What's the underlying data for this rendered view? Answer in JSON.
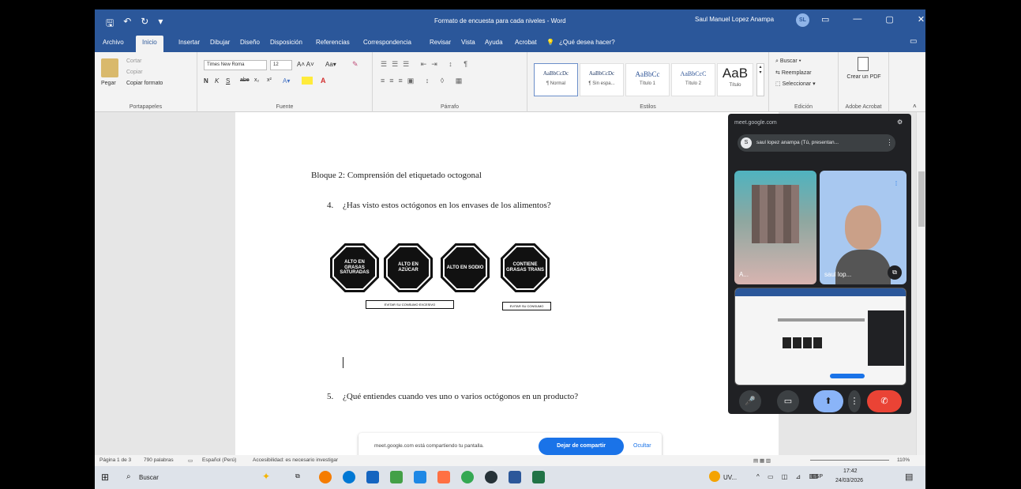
{
  "titlebar": {
    "qat": [
      "🖫",
      "↶",
      "↻",
      "▾"
    ],
    "doc_title": "Formato de encuesta para cada niveles - Word",
    "user_name": "Saul Manuel Lopez Anampa",
    "user_initials": "SL",
    "window_buttons": [
      "▭",
      "—",
      "▢",
      "✕"
    ]
  },
  "tabs": {
    "items": [
      "Archivo",
      "Inicio",
      "Insertar",
      "Dibujar",
      "Diseño",
      "Disposición",
      "Referencias",
      "Correspondencia",
      "Revisar",
      "Vista",
      "Ayuda",
      "Acrobat"
    ],
    "active": "Inicio",
    "tell_me": "¿Qué desea hacer?"
  },
  "ribbon": {
    "clipboard": {
      "paste": "Pegar",
      "cut": "Cortar",
      "copy": "Copiar",
      "format_painter": "Copiar formato",
      "label": "Portapapeles"
    },
    "font": {
      "name": "Times New Roma",
      "size": "12",
      "label": "Fuente",
      "buttons": [
        "N",
        "K",
        "S",
        "abe",
        "x₂",
        "x²"
      ]
    },
    "paragraph": {
      "label": "Párrafo"
    },
    "styles": {
      "label": "Estilos",
      "items": [
        {
          "sample": "AaBbCcDc",
          "name": "¶ Normal"
        },
        {
          "sample": "AaBbCcDc",
          "name": "¶ Sin espa..."
        },
        {
          "sample": "AaBbCc",
          "name": "Título 1"
        },
        {
          "sample": "AaBbCcC",
          "name": "Título 2"
        },
        {
          "sample": "AaB",
          "name": "Título"
        }
      ]
    },
    "editing": {
      "find": "Buscar",
      "replace": "Reemplazar",
      "select": "Seleccionar",
      "label": "Edición"
    },
    "acrobat": {
      "create_pdf": "Crear un PDF",
      "label": "Adobe Acrobat"
    }
  },
  "document": {
    "block_title": "Bloque 2: Comprensión del etiquetado octogonal",
    "q4_number": "4.",
    "q4_text": "¿Has visto estos octógonos en los envases de los alimentos?",
    "octagons": [
      "ALTO EN GRASAS SATURADAS",
      "ALTO EN AZÚCAR",
      "ALTO EN SODIO",
      "CONTIENE GRASAS TRANS"
    ],
    "caption1": "EVITAR SU CONSUMO EXCESIVO",
    "caption2": "EVITAR SU CONSUMO",
    "q5_number": "5.",
    "q5_text": "¿Qué entiendes cuando ves uno o varios octógonos en un producto?"
  },
  "meet": {
    "domain": "meet.google.com",
    "presenter_initial": "S",
    "presenter_text": "saul lopez anampa (Tú, presentan...",
    "tile1_name": "A...",
    "tile2_name": "saul lop...",
    "controls": [
      "🎤",
      "▭",
      "⬆",
      "⋮",
      "✆"
    ]
  },
  "sharebar": {
    "message": "meet.google.com está compartiendo tu pantalla.",
    "stop_label": "Dejar de compartir",
    "hide_label": "Ocultar"
  },
  "statusbar": {
    "page": "Página 1 de 3",
    "words": "790 palabras",
    "language": "Español (Perú)",
    "accessibility": "Accesibilidad: es necesario investigar",
    "zoom": "110%"
  },
  "taskbar": {
    "search": "Buscar",
    "weather": "UV...",
    "lang": "ESP",
    "time": "17:42",
    "date": "24/03/2026"
  },
  "colors": {
    "word_blue": "#2b579a",
    "meet_dark": "#202124",
    "meet_blue": "#1a73e8",
    "hangup_red": "#ea4335"
  }
}
